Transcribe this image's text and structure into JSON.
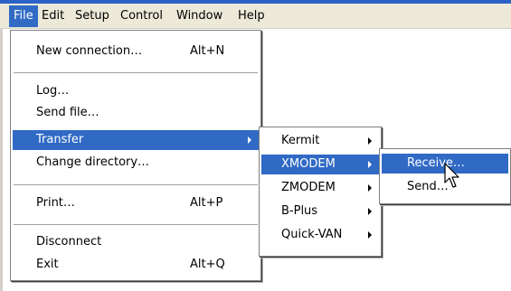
{
  "menubar": {
    "items": [
      {
        "label": "File"
      },
      {
        "label": "Edit"
      },
      {
        "label": "Setup"
      },
      {
        "label": "Control"
      },
      {
        "label": "Window"
      },
      {
        "label": "Help"
      }
    ]
  },
  "file_menu": {
    "new_connection": {
      "label": "New connection…",
      "shortcut": "Alt+N"
    },
    "log": {
      "label": "Log…"
    },
    "send_file": {
      "label": "Send file…"
    },
    "transfer": {
      "label": "Transfer"
    },
    "change_directory": {
      "label": "Change directory…"
    },
    "print": {
      "label": "Print…",
      "shortcut": "Alt+P"
    },
    "disconnect": {
      "label": "Disconnect"
    },
    "exit": {
      "label": "Exit",
      "shortcut": "Alt+Q"
    }
  },
  "transfer_menu": {
    "items": [
      {
        "label": "Kermit"
      },
      {
        "label": "XMODEM"
      },
      {
        "label": "ZMODEM"
      },
      {
        "label": "B-Plus"
      },
      {
        "label": "Quick-VAN"
      }
    ]
  },
  "xmodem_menu": {
    "receive": {
      "label": "Receive…"
    },
    "send": {
      "label": "Send…"
    }
  },
  "cursor": {
    "icon": "arrow-pointer-icon"
  },
  "colors": {
    "highlight": "#316ac5",
    "menubar": "#ece9d8"
  }
}
